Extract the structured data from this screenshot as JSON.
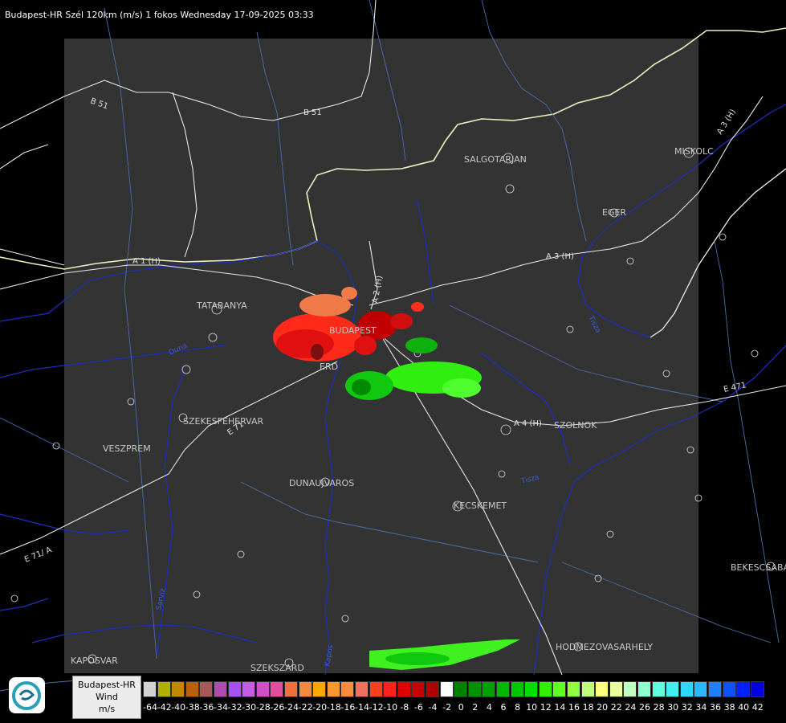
{
  "header": {
    "title": "Budapest-HR Szél 120km (m/s) 1 fokos Wednesday 17-09-2025 03:33"
  },
  "map": {
    "cities": [
      "SALGOTARJAN",
      "MISKOLC",
      "EGER",
      "TATABANYA",
      "BUDAPEST",
      "ERD",
      "SZEKESFEHERVAR",
      "VESZPREM",
      "DUNAUJVAROS",
      "KECSKEMET",
      "SZOLNOK",
      "BEKESCSABA",
      "HODMEZOVASARHELY",
      "KAPOSVAR",
      "SZEKSZARD"
    ],
    "roads": [
      "B 51",
      "B 51",
      "A 1 (H)",
      "A 3 (H)",
      "A 3 (H)",
      "A 2 (H)",
      "E 71",
      "E 471",
      "A 4 (H)",
      "E 71/ A"
    ],
    "rivers": [
      "Duna",
      "Tisza",
      "Tisza",
      "Sarviz",
      "Kapos"
    ]
  },
  "legend": {
    "station": "Budapest-HR",
    "quantity": "Wind",
    "unit": "m/s",
    "ticks": [
      "-64",
      "-42",
      "-40",
      "-38",
      "-36",
      "-34",
      "-32",
      "-30",
      "-28",
      "-26",
      "-24",
      "-22",
      "-20",
      "-18",
      "-16",
      "-14",
      "-12",
      "-10",
      "-8",
      "-6",
      "-4",
      "-2",
      "0",
      "2",
      "4",
      "6",
      "8",
      "10",
      "12",
      "14",
      "16",
      "18",
      "20",
      "22",
      "24",
      "26",
      "28",
      "30",
      "32",
      "34",
      "36",
      "38",
      "40",
      "42"
    ],
    "colors": [
      "#d2d2d2",
      "#b0b000",
      "#c08a00",
      "#b8600c",
      "#a85858",
      "#b04cb0",
      "#a850f0",
      "#c060e0",
      "#d050c8",
      "#e050a0",
      "#f07040",
      "#f08a40",
      "#f8a800",
      "#f89830",
      "#f88c40",
      "#f07060",
      "#f84020",
      "#ff2020",
      "#e00000",
      "#c80000",
      "#b00000",
      "#ffffff",
      "#008000",
      "#009000",
      "#00a000",
      "#00b800",
      "#00c800",
      "#00e000",
      "#30f000",
      "#60ff20",
      "#90ff40",
      "#c0ff80",
      "#ffff80",
      "#e8ffa0",
      "#c0ffc0",
      "#90ffd0",
      "#60ffe0",
      "#40f0f0",
      "#30d8ff",
      "#30b8ff",
      "#2080ff",
      "#1050ff",
      "#0020ff",
      "#0000e0"
    ]
  }
}
